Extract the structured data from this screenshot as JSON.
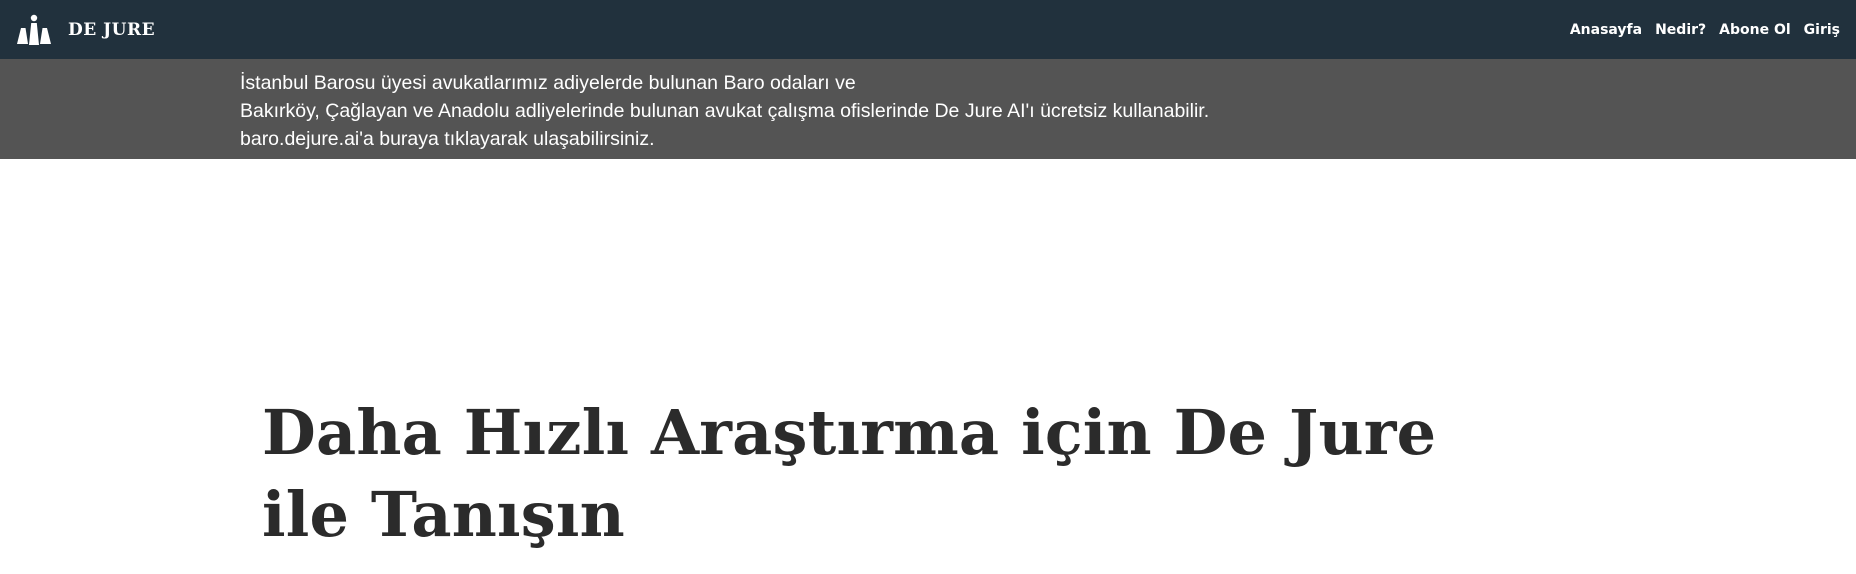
{
  "header": {
    "brand_name": "DE JURE",
    "logo_icon": "scales-of-justice-icon",
    "background_color": "#21313d",
    "nav": [
      {
        "label": "Anasayfa"
      },
      {
        "label": "Nedir?"
      },
      {
        "label": "Abone Ol"
      },
      {
        "label": "Giriş"
      }
    ]
  },
  "banner": {
    "background_color": "#545454",
    "lines": [
      "İstanbul Barosu üyesi avukatlarımız adiyelerde bulunan Baro odaları ve",
      "Bakırköy, Çağlayan ve Anadolu adliyelerinde bulunan avukat çalışma ofislerinde De Jure AI'ı ücretsiz kullanabilir.",
      "baro.dejure.ai'a buraya tıklayarak ulaşabilirsiniz."
    ]
  },
  "hero": {
    "title_line_1": "Daha Hızlı Araştırma için De Jure",
    "title_line_2": "ile Tanışın",
    "text_color": "#2b2b2b"
  }
}
